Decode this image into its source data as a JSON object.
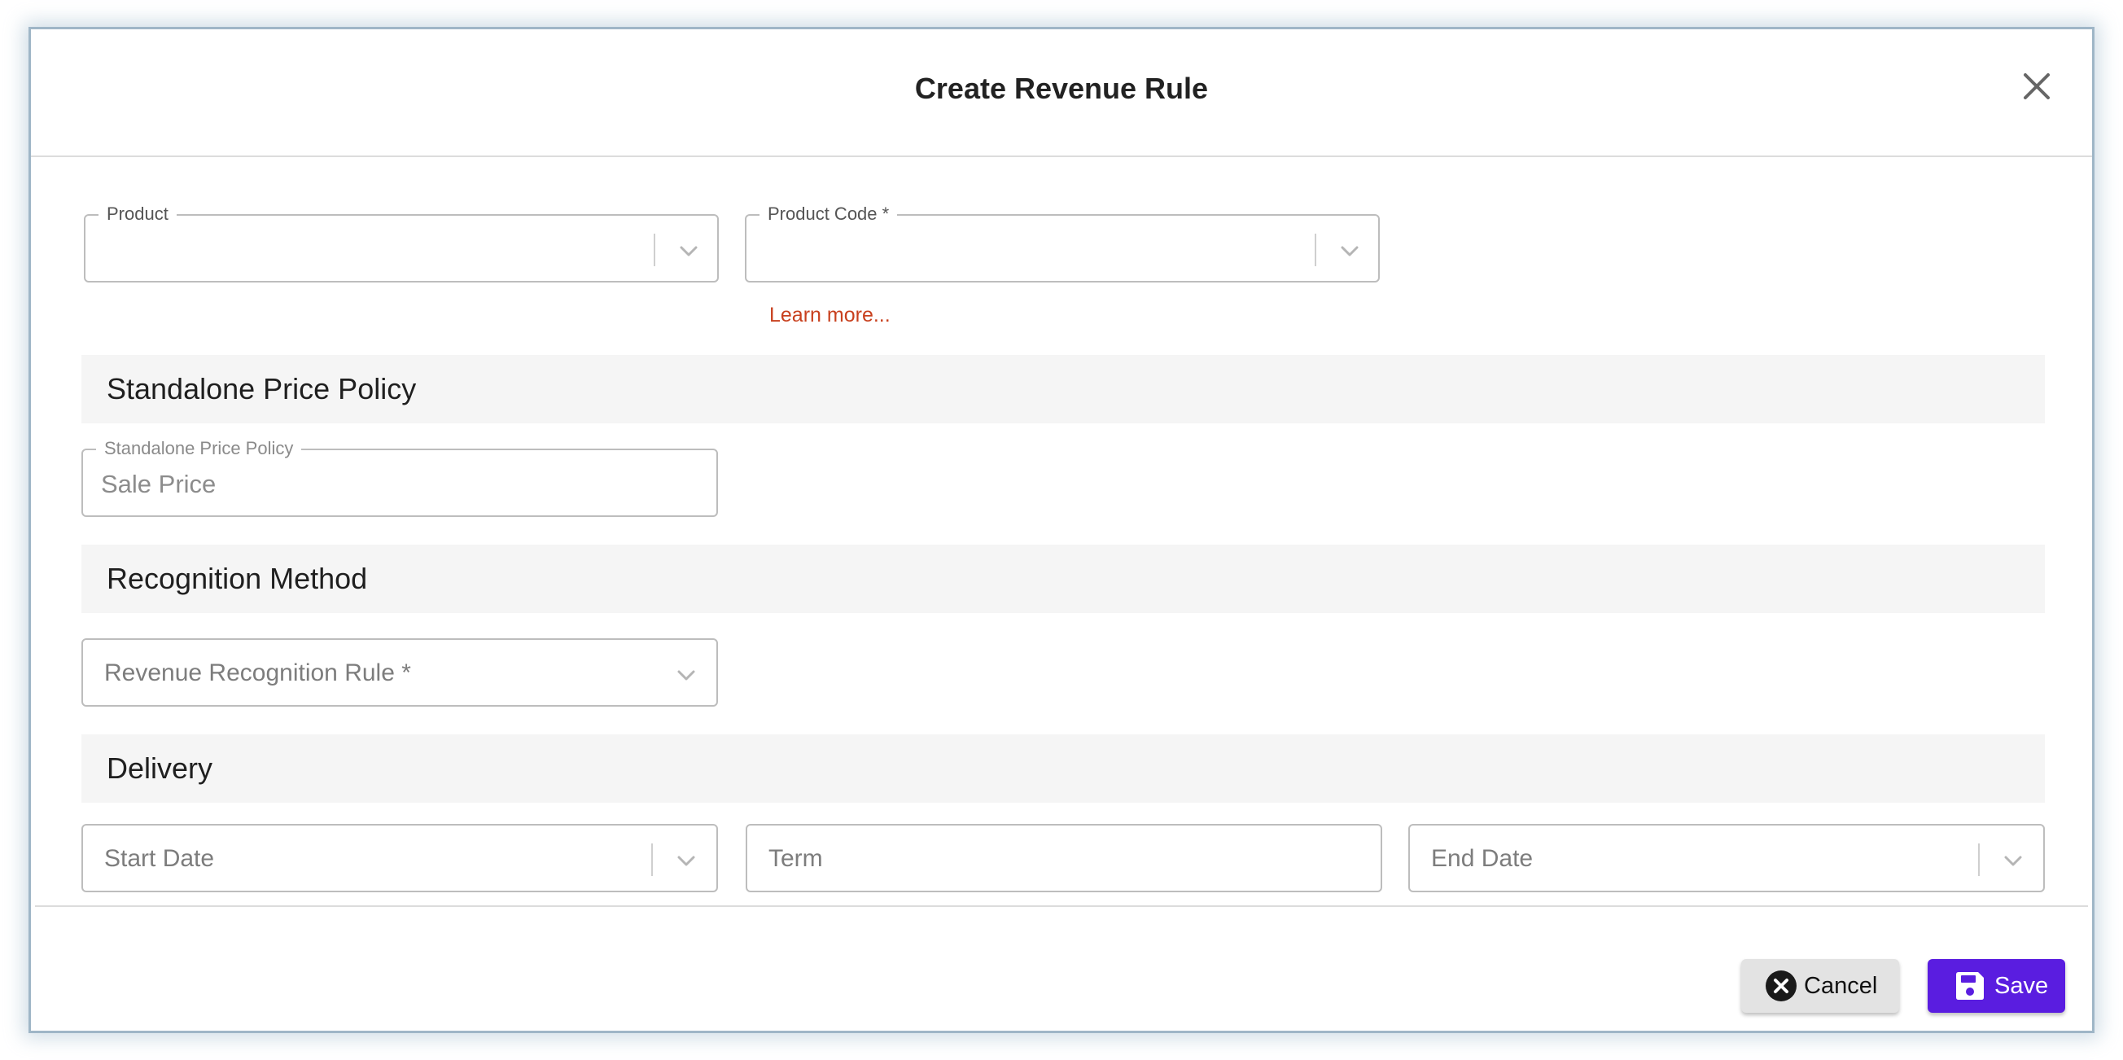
{
  "modal": {
    "title": "Create Revenue Rule"
  },
  "fields": {
    "product": {
      "label": "Product",
      "value": ""
    },
    "product_code": {
      "label": "Product Code *",
      "value": ""
    },
    "learn_more": "Learn more...",
    "standalone_price_policy": {
      "label": "Standalone Price Policy",
      "value": "Sale Price"
    },
    "revenue_recognition_rule": {
      "placeholder": "Revenue Recognition Rule *"
    },
    "start_date": {
      "placeholder": "Start Date"
    },
    "term": {
      "placeholder": "Term"
    },
    "end_date": {
      "placeholder": "End Date"
    }
  },
  "sections": {
    "standalone_price_policy": "Standalone Price Policy",
    "recognition_method": "Recognition Method",
    "delivery": "Delivery"
  },
  "footer": {
    "cancel_label": "Cancel",
    "save_label": "Save"
  },
  "icons": {
    "close": "close-icon",
    "chevron": "chevron-down-icon",
    "cancel": "x-circle-icon",
    "save": "floppy-disk-icon"
  },
  "colors": {
    "accent": "#5a1de0",
    "link": "#c8401e",
    "modal_border": "#9fb6c7",
    "section_bg": "#f5f5f5"
  }
}
